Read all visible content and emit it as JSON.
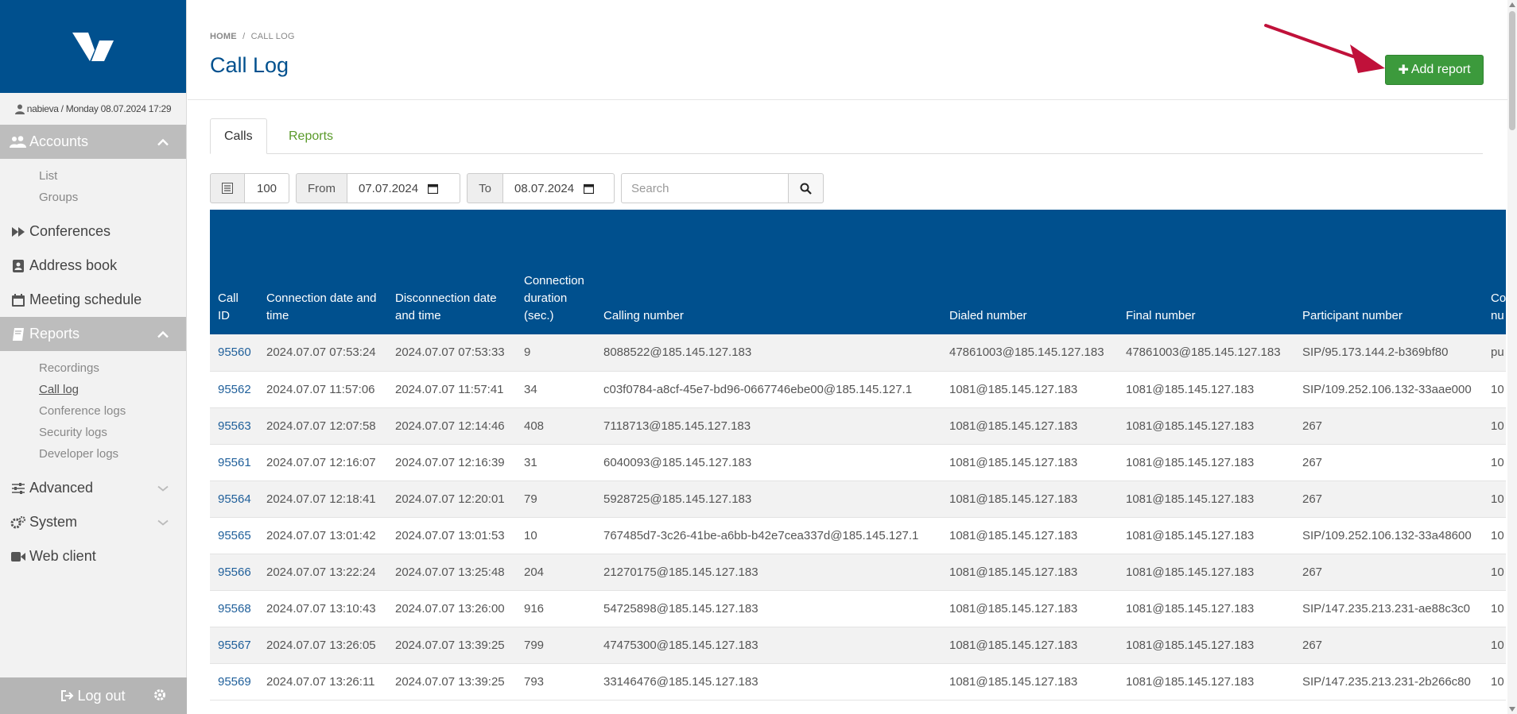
{
  "user": {
    "text": "nabieva / Monday 08.07.2024 17:29"
  },
  "nav": {
    "accounts": {
      "label": "Accounts",
      "items": [
        "List",
        "Groups"
      ]
    },
    "conferences": {
      "label": "Conferences"
    },
    "address_book": {
      "label": "Address book"
    },
    "meeting_schedule": {
      "label": "Meeting schedule"
    },
    "reports": {
      "label": "Reports",
      "items": [
        "Recordings",
        "Call log",
        "Conference logs",
        "Security logs",
        "Developer logs"
      ]
    },
    "advanced": {
      "label": "Advanced"
    },
    "system": {
      "label": "System"
    },
    "web_client": {
      "label": "Web client"
    },
    "logout": {
      "label": "Log out"
    }
  },
  "breadcrumb": {
    "home": "HOME",
    "sep": "/",
    "current": "CALL LOG"
  },
  "page": {
    "title": "Call Log",
    "add_button": "Add report"
  },
  "tabs": [
    {
      "label": "Calls"
    },
    {
      "label": "Reports"
    }
  ],
  "filters": {
    "page_size": "100",
    "from_label": "From",
    "from_value": "07.07.2024",
    "to_label": "To",
    "to_value": "08.07.2024",
    "search_placeholder": "Search"
  },
  "table": {
    "headers": [
      "Call ID",
      "Connection date and time",
      "Disconnection date and time",
      "Connection duration (sec.)",
      "Calling number",
      "Dialed number",
      "Final number",
      "Participant number",
      "Co nu"
    ],
    "rows": [
      [
        "95560",
        "2024.07.07 07:53:24",
        "2024.07.07 07:53:33",
        "9",
        "8088522@185.145.127.183",
        "47861003@185.145.127.183",
        "47861003@185.145.127.183",
        "SIP/95.173.144.2-b369bf80",
        "pu"
      ],
      [
        "95562",
        "2024.07.07 11:57:06",
        "2024.07.07 11:57:41",
        "34",
        "c03f0784-a8cf-45e7-bd96-0667746ebe00@185.145.127.1",
        "1081@185.145.127.183",
        "1081@185.145.127.183",
        "SIP/109.252.106.132-33aae000",
        "10"
      ],
      [
        "95563",
        "2024.07.07 12:07:58",
        "2024.07.07 12:14:46",
        "408",
        "7118713@185.145.127.183",
        "1081@185.145.127.183",
        "1081@185.145.127.183",
        "267",
        "10"
      ],
      [
        "95561",
        "2024.07.07 12:16:07",
        "2024.07.07 12:16:39",
        "31",
        "6040093@185.145.127.183",
        "1081@185.145.127.183",
        "1081@185.145.127.183",
        "267",
        "10"
      ],
      [
        "95564",
        "2024.07.07 12:18:41",
        "2024.07.07 12:20:01",
        "79",
        "5928725@185.145.127.183",
        "1081@185.145.127.183",
        "1081@185.145.127.183",
        "267",
        "10"
      ],
      [
        "95565",
        "2024.07.07 13:01:42",
        "2024.07.07 13:01:53",
        "10",
        "767485d7-3c26-41be-a6bb-b42e7cea337d@185.145.127.1",
        "1081@185.145.127.183",
        "1081@185.145.127.183",
        "SIP/109.252.106.132-33a48600",
        "10"
      ],
      [
        "95566",
        "2024.07.07 13:22:24",
        "2024.07.07 13:25:48",
        "204",
        "21270175@185.145.127.183",
        "1081@185.145.127.183",
        "1081@185.145.127.183",
        "267",
        "10"
      ],
      [
        "95568",
        "2024.07.07 13:10:43",
        "2024.07.07 13:26:00",
        "916",
        "54725898@185.145.127.183",
        "1081@185.145.127.183",
        "1081@185.145.127.183",
        "SIP/147.235.213.231-ae88c3c0",
        "10"
      ],
      [
        "95567",
        "2024.07.07 13:26:05",
        "2024.07.07 13:39:25",
        "799",
        "47475300@185.145.127.183",
        "1081@185.145.127.183",
        "1081@185.145.127.183",
        "267",
        "10"
      ],
      [
        "95569",
        "2024.07.07 13:26:11",
        "2024.07.07 13:39:25",
        "793",
        "33146476@185.145.127.183",
        "1081@185.145.127.183",
        "1081@185.145.127.183",
        "SIP/147.235.213.231-2b266c80",
        "10"
      ]
    ]
  },
  "colors": {
    "brand": "#00508e",
    "accent_green": "#3c9a3c",
    "link": "#1f5f9a",
    "annotation_arrow": "#c0113a"
  },
  "icons": [
    "logo-icon",
    "user-icon",
    "users-icon",
    "chevron-up-icon",
    "forward-icon",
    "address-book-icon",
    "calendar-icon",
    "book-icon",
    "sliders-icon",
    "cogs-icon",
    "video-camera-icon",
    "logout-icon",
    "gear-icon",
    "list-icon",
    "calendar-picker-icon",
    "search-icon",
    "plus-icon"
  ]
}
